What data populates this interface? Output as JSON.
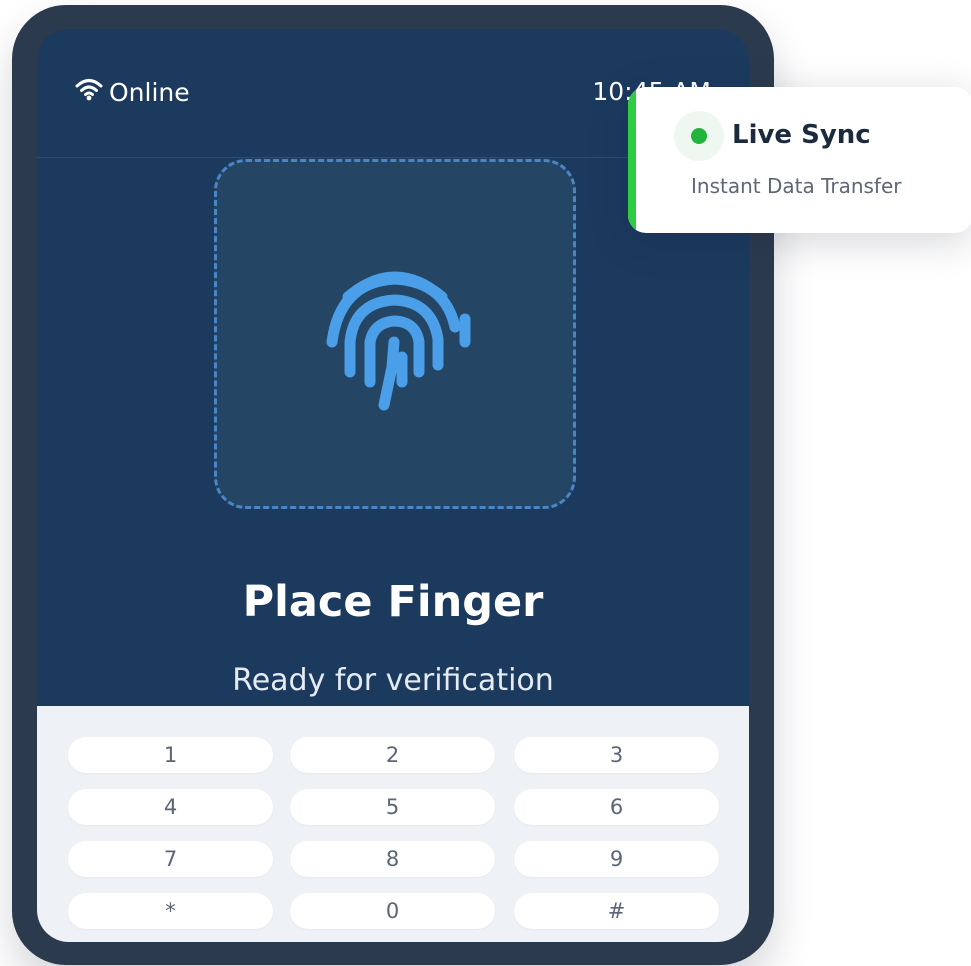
{
  "status": {
    "network_label": "Online",
    "time": "10:45 AM"
  },
  "scanner": {
    "icon": "fingerprint-icon",
    "title": "Place Finger",
    "subtitle": "Ready for verification"
  },
  "keypad": {
    "keys": [
      "1",
      "2",
      "3",
      "4",
      "5",
      "6",
      "7",
      "8",
      "9",
      "*",
      "0",
      "#"
    ]
  },
  "sync_card": {
    "title": "Live Sync",
    "subtitle": "Instant Data Transfer"
  },
  "colors": {
    "screen_bg": "#1b3a5e",
    "frame": "#2c3a4e",
    "fingerprint": "#4a9fe8",
    "sync_accent": "#2ecc40",
    "sync_dot": "#22b33a"
  }
}
